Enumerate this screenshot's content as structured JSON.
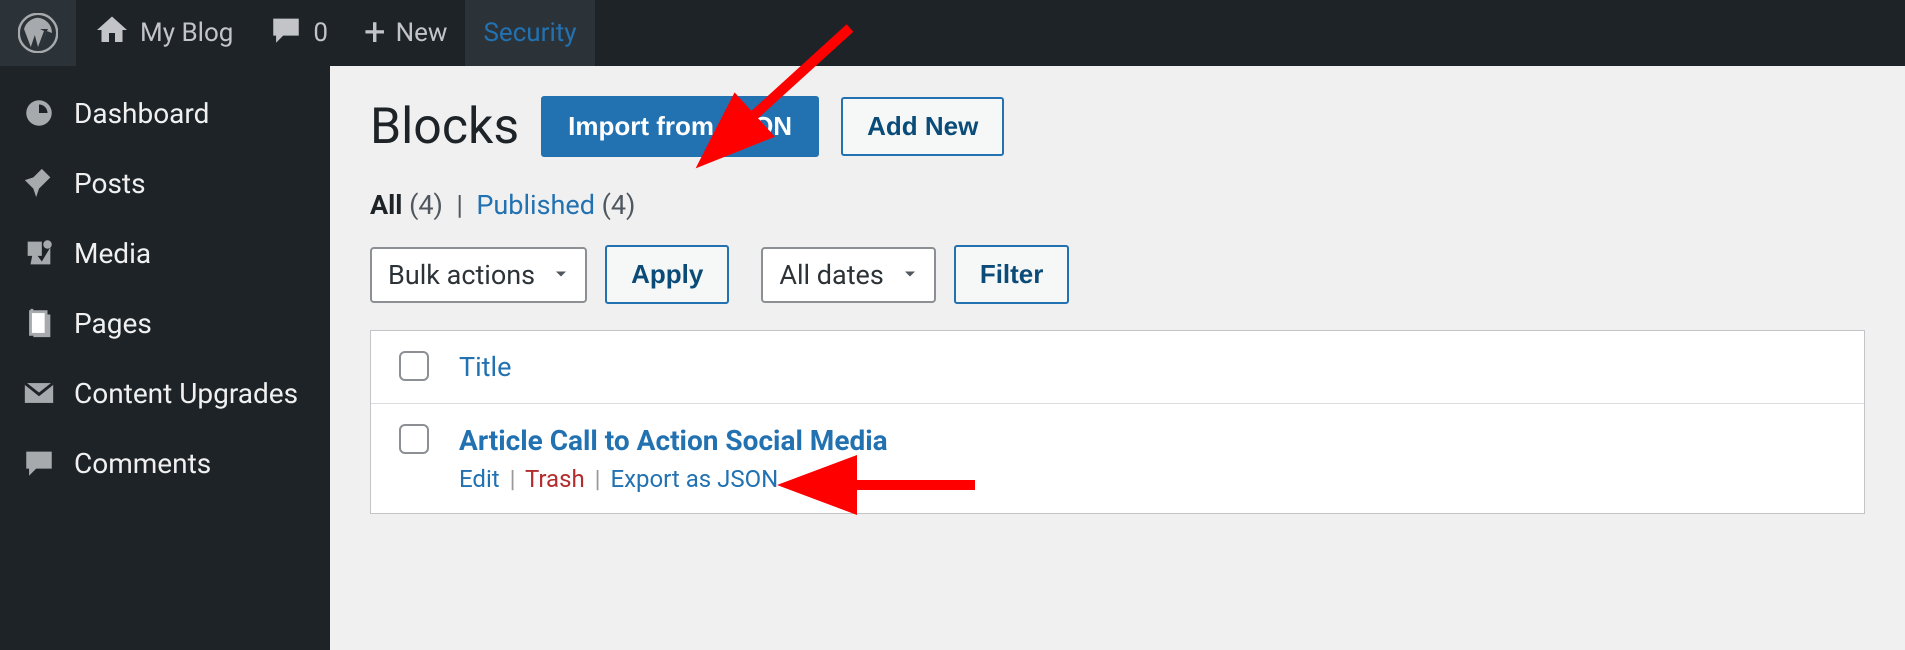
{
  "adminbar": {
    "site_name": "My Blog",
    "comments_count": "0",
    "new_label": "New",
    "security_label": "Security"
  },
  "sidebar": {
    "items": [
      {
        "label": "Dashboard",
        "icon": "dashboard"
      },
      {
        "label": "Posts",
        "icon": "pin"
      },
      {
        "label": "Media",
        "icon": "media"
      },
      {
        "label": "Pages",
        "icon": "pages"
      },
      {
        "label": "Content Upgrades",
        "icon": "mail"
      },
      {
        "label": "Comments",
        "icon": "speech"
      }
    ]
  },
  "page": {
    "title": "Blocks",
    "import_btn": "Import from JSON",
    "add_btn": "Add New"
  },
  "filters": {
    "all_label": "All",
    "all_count": "(4)",
    "published_label": "Published",
    "published_count": "(4)",
    "pipe": "|"
  },
  "tablenav": {
    "bulk_label": "Bulk actions",
    "apply_label": "Apply",
    "dates_label": "All dates",
    "filter_label": "Filter"
  },
  "table": {
    "header_title": "Title",
    "row": {
      "title": "Article Call to Action Social Media",
      "edit": "Edit",
      "trash": "Trash",
      "export": "Export as JSON"
    }
  }
}
